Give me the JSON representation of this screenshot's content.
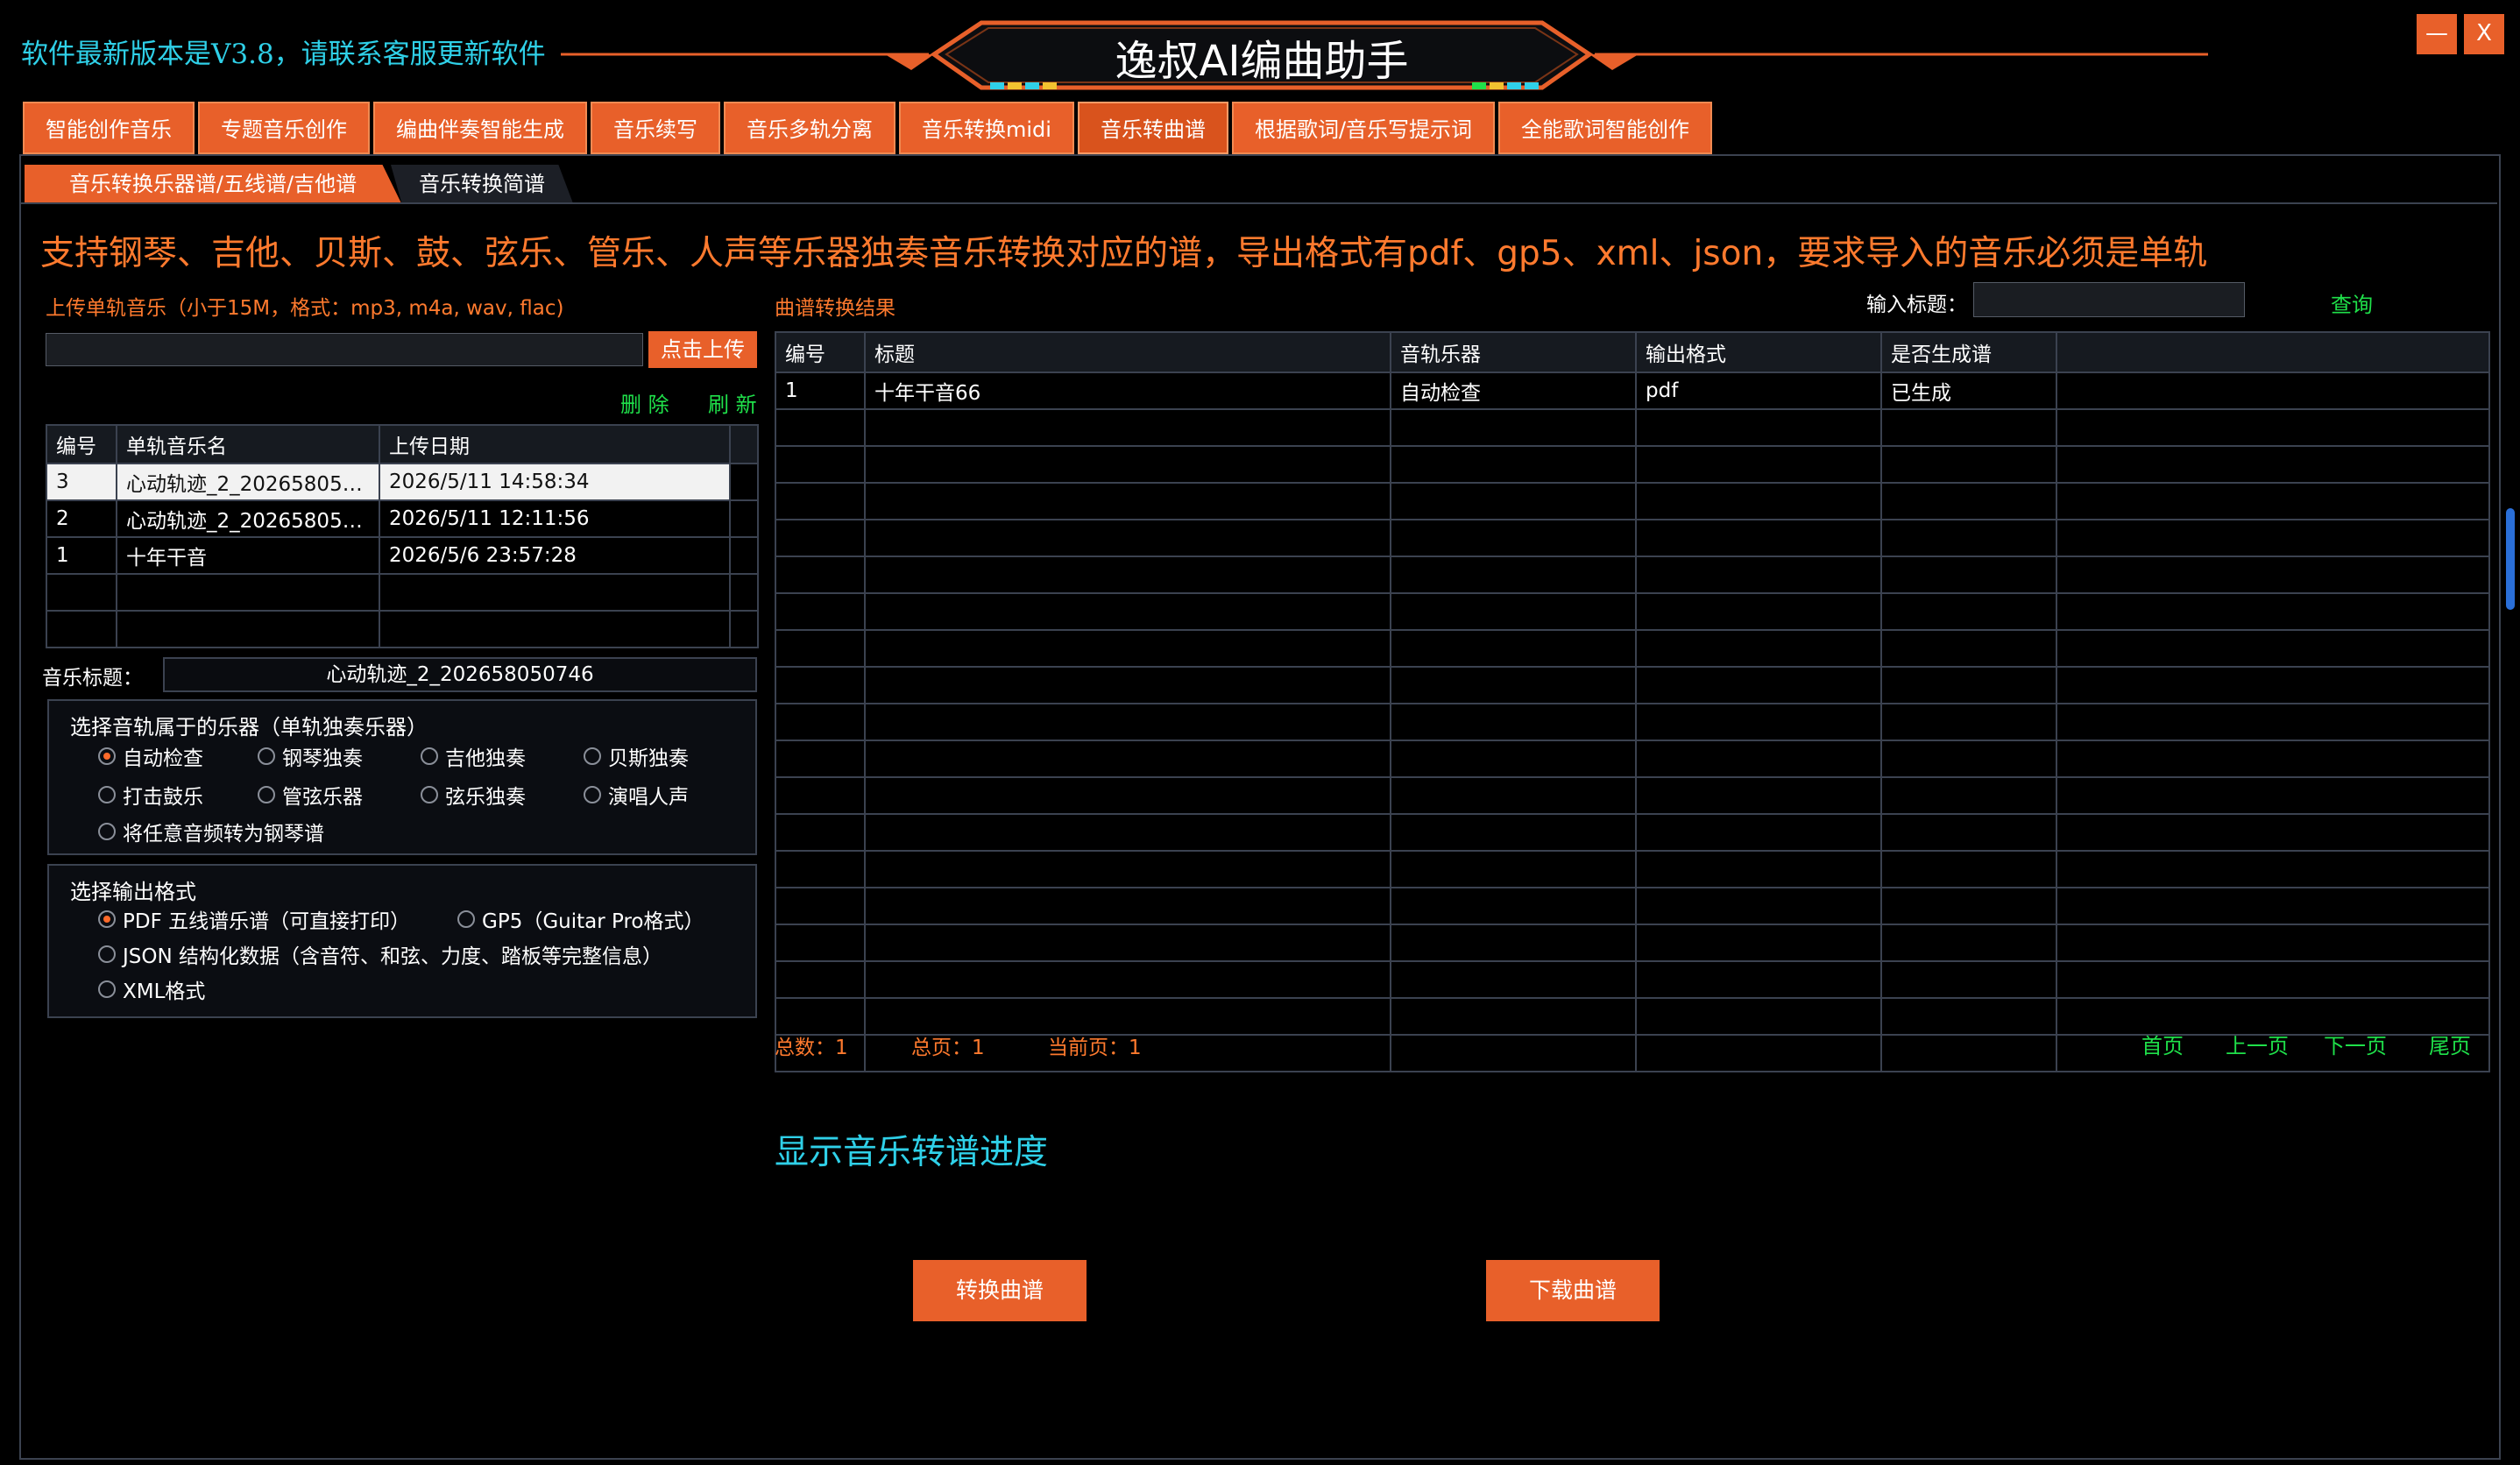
{
  "notice": "软件最新版本是V3.8，请联系客服更新软件",
  "app_title": "逸叔AI编曲助手",
  "window": {
    "minimize": "—",
    "close": "X"
  },
  "main_tabs": [
    "智能创作音乐",
    "专题音乐创作",
    "编曲伴奏智能生成",
    "音乐续写",
    "音乐多轨分离",
    "音乐转换midi",
    "音乐转曲谱",
    "根据歌词/音乐写提示词",
    "全能歌词智能创作"
  ],
  "active_main_tab": "音乐转曲谱",
  "sub_tabs": [
    "音乐转换乐器谱/五线谱/吉他谱",
    "音乐转换简谱"
  ],
  "headline": "支持钢琴、吉他、贝斯、鼓、弦乐、管乐、人声等乐器独奏音乐转换对应的谱，导出格式有pdf、gp5、xml、json，要求导入的音乐必须是单轨",
  "upload": {
    "label": "上传单轨音乐（小于15M，格式：mp3, m4a, wav, flac)",
    "input_value": "",
    "button": "点击上传",
    "delete": "删 除",
    "refresh": "刷 新"
  },
  "upload_table": {
    "headers": [
      "编号",
      "单轨音乐名",
      "上传日期"
    ],
    "rows": [
      [
        "3",
        "心动轨迹_2_202658050...",
        "2026/5/11 14:58:34"
      ],
      [
        "2",
        "心动轨迹_2_202658050...",
        "2026/5/11 12:11:56"
      ],
      [
        "1",
        "十年干音",
        "2026/5/6 23:57:28"
      ]
    ],
    "selected_row": 0
  },
  "music_title": {
    "label": "音乐标题：",
    "value": "心动轨迹_2_202658050746"
  },
  "instrument_group": {
    "title": "选择音轨属于的乐器（单轨独奏乐器）",
    "options": [
      "自动检查",
      "钢琴独奏",
      "吉他独奏",
      "贝斯独奏",
      "打击鼓乐",
      "管弦乐器",
      "弦乐独奏",
      "演唱人声",
      "将任意音频转为钢琴谱"
    ],
    "selected": "自动检查"
  },
  "format_group": {
    "title": "选择输出格式",
    "options": [
      "PDF 五线谱乐谱（可直接打印）",
      "GP5（Guitar Pro格式）",
      "JSON 结构化数据（含音符、和弦、力度、踏板等完整信息）",
      "XML格式"
    ],
    "selected": "PDF 五线谱乐谱（可直接打印）"
  },
  "result": {
    "label": "曲谱转换结果",
    "search_label": "输入标题：",
    "search_value": "",
    "search_button": "查询",
    "headers": [
      "编号",
      "标题",
      "音轨乐器",
      "输出格式",
      "是否生成谱"
    ],
    "rows": [
      [
        "1",
        "十年干音66",
        "自动检查",
        "pdf",
        "已生成"
      ]
    ],
    "total": "总数：1",
    "pages": "总页：1",
    "current": "当前页：1",
    "nav": [
      "首页",
      "上一页",
      "下一页",
      "尾页"
    ]
  },
  "progress_text": "显示音乐转谱进度",
  "buttons": {
    "convert": "转换曲谱",
    "download": "下载曲谱"
  },
  "colors": {
    "accent": "#e8602a",
    "cyan": "#2fd0e8",
    "green": "#1fe04a",
    "orange_text": "#ff7a2e"
  }
}
